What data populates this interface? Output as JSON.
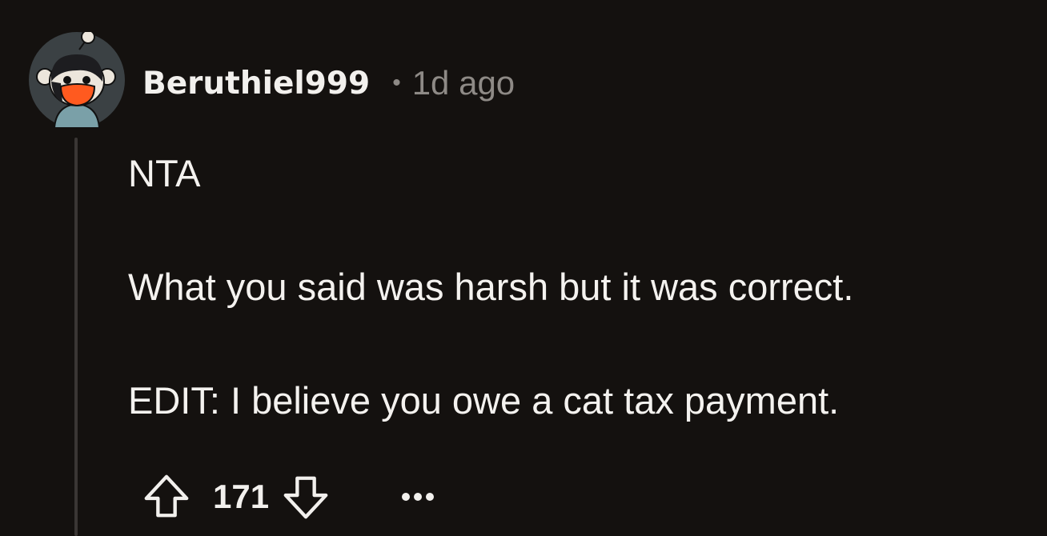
{
  "comment": {
    "author": "Beruthiel999",
    "separator": "•",
    "timestamp": "1d ago",
    "body": [
      "NTA",
      "What you said was harsh but it was correct.",
      "EDIT: I believe you owe a cat tax payment."
    ],
    "score": "171"
  },
  "icons": {
    "upvote": "arrow-up-icon",
    "downvote": "arrow-down-icon",
    "more": "ellipsis-icon",
    "avatar": "snoo-avatar"
  },
  "colors": {
    "background": "#14110f",
    "text": "#f4f2ef",
    "meta": "#8e8a86",
    "thread_line": "#3a3634",
    "avatar_bg": "#3b4144",
    "avatar_mask": "#ff5a1f"
  }
}
